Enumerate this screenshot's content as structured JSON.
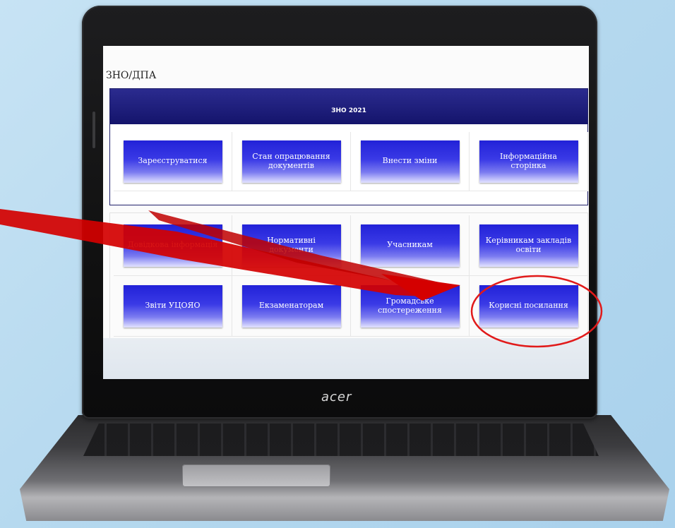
{
  "screen": {
    "page_title": "ЗНО/ДПА",
    "zno_header": "ЗНО 2021",
    "zno_buttons": [
      {
        "label": "Зареєструватися"
      },
      {
        "label": "Стан опрацювання документів"
      },
      {
        "label": "Внести зміни"
      },
      {
        "label": "Інформаційна сторінка"
      }
    ],
    "grid_row1": [
      {
        "label": "Довідкова інформація"
      },
      {
        "label": "Нормативні документи"
      },
      {
        "label": "Учасникам"
      },
      {
        "label": "Керівникам закладів освіти"
      }
    ],
    "grid_row2": [
      {
        "label": "Звіти УЦОЯО"
      },
      {
        "label": "Екзаменаторам"
      },
      {
        "label": "Громадське спостереження"
      },
      {
        "label": "Корисні посилання"
      }
    ]
  },
  "laptop": {
    "brand": "acer"
  },
  "annotations": {
    "arrow_color": "#d40000",
    "highlight_circle_color": "#e11a1a",
    "highlight_target": "Корисні посилання"
  }
}
